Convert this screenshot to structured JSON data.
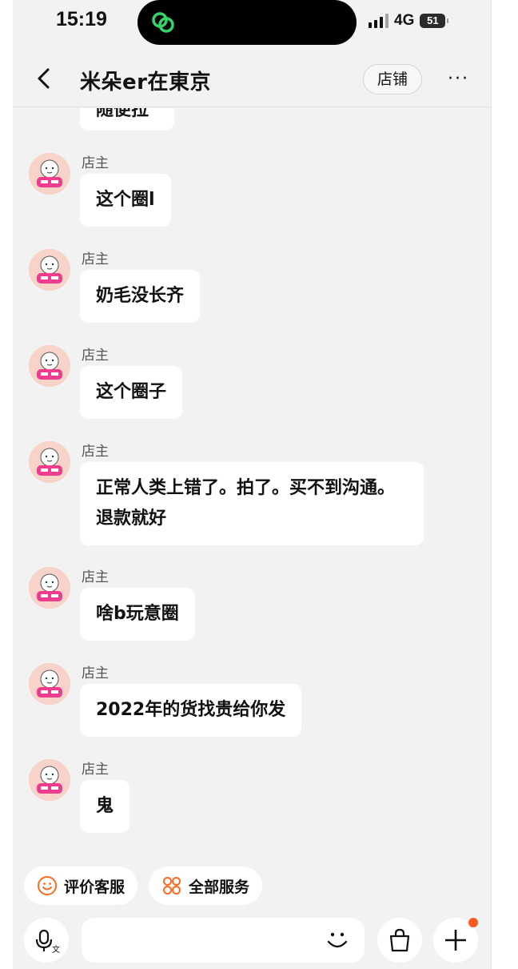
{
  "status_bar": {
    "time": "15:19",
    "network": "4G",
    "battery": "51"
  },
  "nav": {
    "title": "米朵er在東京",
    "shop_button": "店铺",
    "more_label": "···"
  },
  "partial_message": "随便拉",
  "messages": [
    {
      "sender": "店主",
      "text": "这个圈l"
    },
    {
      "sender": "店主",
      "text": "奶毛没长齐"
    },
    {
      "sender": "店主",
      "text": "这个圈子"
    },
    {
      "sender": "店主",
      "text": "正常人类上错了。拍了。买不到沟通。退款就好"
    },
    {
      "sender": "店主",
      "text": "啥b玩意圈"
    },
    {
      "sender": "店主",
      "text": "2022年的货找贵给你发"
    },
    {
      "sender": "店主",
      "text": "鬼"
    }
  ],
  "quick_actions": [
    {
      "label": "评价客服",
      "icon": "smile-icon"
    },
    {
      "label": "全部服务",
      "icon": "grid-icon"
    }
  ],
  "input": {
    "placeholder": ""
  },
  "colors": {
    "background": "#f2f2f2",
    "bubble": "#ffffff",
    "accent": "#ff5a1f",
    "island_logo": "#35d36a"
  }
}
